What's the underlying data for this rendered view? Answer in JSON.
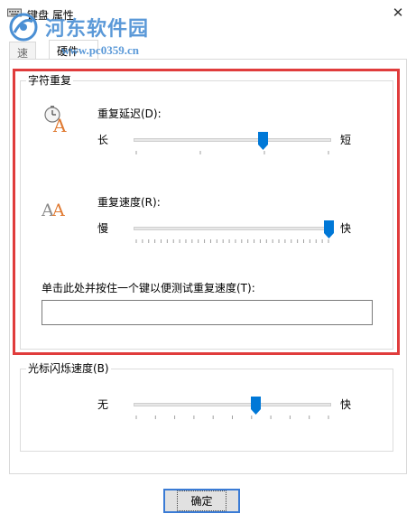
{
  "window": {
    "title": "键盘 属性",
    "close_symbol": "✕"
  },
  "watermark": {
    "title": "河东软件园",
    "url": "www.pc0359.cn"
  },
  "tabs": [
    {
      "label": "速度",
      "selected": true
    },
    {
      "label": "硬件",
      "selected": false
    }
  ],
  "char_repeat": {
    "group_label": "字符重复",
    "delay": {
      "label": "重复延迟(D):",
      "min_label": "长",
      "max_label": "短",
      "value_fraction": 0.66,
      "tick_count": 4
    },
    "rate": {
      "label": "重复速度(R):",
      "min_label": "慢",
      "max_label": "快",
      "value_fraction": 1.0,
      "tick_count": 32
    },
    "test": {
      "label": "单击此处并按住一个键以便测试重复速度(T):",
      "value": ""
    }
  },
  "cursor_blink": {
    "group_label": "光标闪烁速度(B)",
    "min_label": "无",
    "max_label": "快",
    "value_fraction": 0.62,
    "tick_count": 11
  },
  "buttons": {
    "ok": "确定"
  },
  "colors": {
    "accent": "#0078d7",
    "highlight_border": "#e03c3c"
  }
}
